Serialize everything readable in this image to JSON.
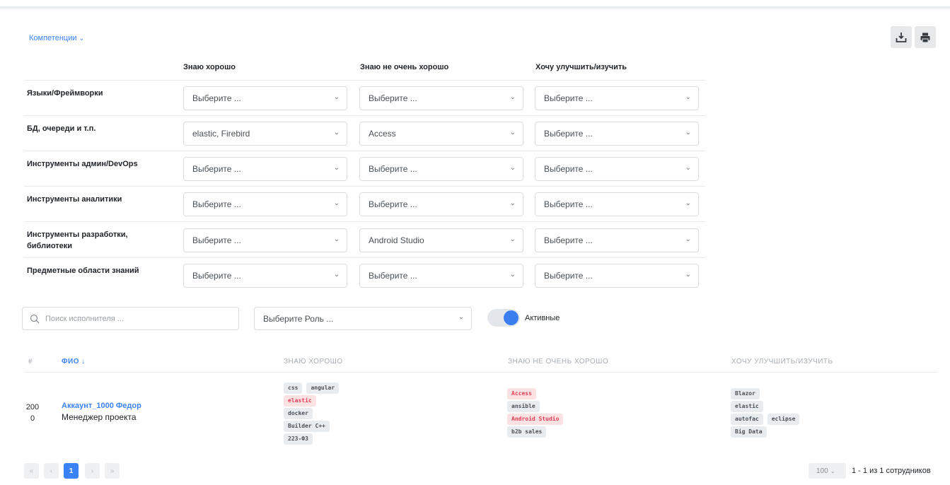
{
  "competencies_toggle": "Компетенции",
  "columns": [
    "Знаю хорошо",
    "Знаю не очень хорошо",
    "Хочу улучшить/изучить"
  ],
  "matrix": [
    {
      "label": "Языки/Фреймворки",
      "values": [
        "Выберите ...",
        "Выберите ...",
        "Выберите ..."
      ]
    },
    {
      "label": "БД, очереди и т.п.",
      "values": [
        "elastic, Firebird",
        "Access",
        "Выберите ..."
      ]
    },
    {
      "label": "Инструменты админ/DevOps",
      "values": [
        "Выберите ...",
        "Выберите ...",
        "Выберите ..."
      ]
    },
    {
      "label": "Инструменты аналитики",
      "values": [
        "Выберите ...",
        "Выберите ...",
        "Выберите ..."
      ]
    },
    {
      "label": "Инструменты разработки, библиотеки",
      "values": [
        "Выберите ...",
        "Android Studio",
        "Выберите ..."
      ]
    },
    {
      "label": "Предметные области знаний",
      "values": [
        "Выберите ...",
        "Выберите ...",
        "Выберите ..."
      ]
    }
  ],
  "filters": {
    "search_placeholder": "Поиск исполнителя ...",
    "role_placeholder": "Выберите Роль ...",
    "active_label": "Активные",
    "active_on": true
  },
  "table": {
    "headers": {
      "num": "#",
      "fio": "ФИО",
      "know_well": "ЗНАЮ ХОРОШО",
      "know_poor": "ЗНАЮ НЕ ОЧЕНЬ ХОРОШО",
      "want": "ХОЧУ УЛУЧШИТЬ/ИЗУЧИТЬ"
    },
    "rows": [
      {
        "num_line1": "200",
        "num_line2": "0",
        "name": "Аккаунт_1000 Федор",
        "role": "Менеджер проекта",
        "know_well": [
          [
            "css",
            "angular"
          ],
          [
            "elastic"
          ],
          [
            "docker"
          ],
          [
            "Builder C++"
          ],
          [
            "223-ФЗ"
          ]
        ],
        "know_poor": [
          [
            "Access"
          ],
          [
            "ansible"
          ],
          [
            "Android Studio"
          ],
          [
            "b2b sales"
          ]
        ],
        "want": [
          [
            "Blazor"
          ],
          [
            "elastic"
          ],
          [
            "autofac",
            "eclipse"
          ],
          [
            "Big Data"
          ]
        ]
      }
    ]
  },
  "highlighted_tags": [
    "elastic",
    "Access",
    "Android Studio"
  ],
  "pagination": {
    "first": "«",
    "prev": "‹",
    "current": "1",
    "next": "›",
    "last": "»",
    "page_size": "100",
    "info": "1 - 1 из 1 сотрудников"
  },
  "colors": {
    "accent": "#3b82f6",
    "tag_bg": "#e9ecef",
    "tag_red_bg": "#fde2e4",
    "tag_red_text": "#e03e52"
  }
}
